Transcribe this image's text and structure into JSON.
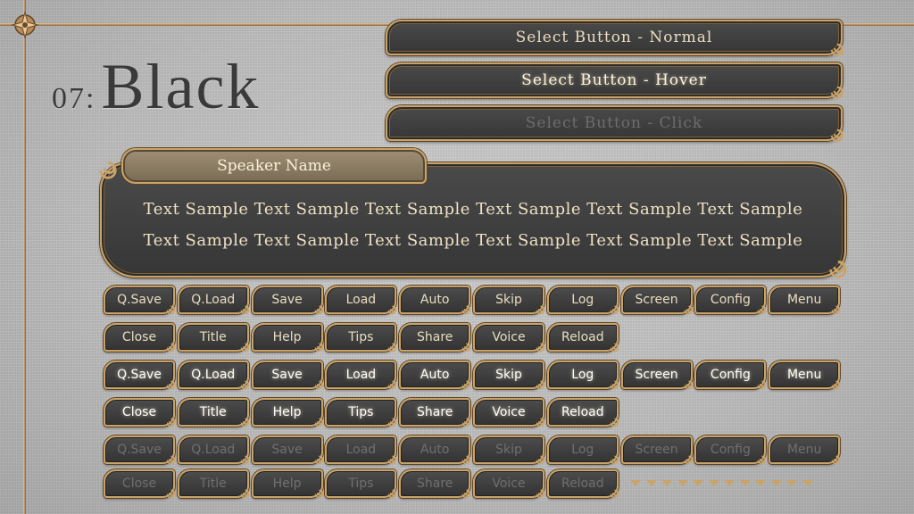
{
  "title": {
    "number": "07:",
    "word": "Black"
  },
  "select_buttons": [
    {
      "label": "Select Button - Normal",
      "state": "normal"
    },
    {
      "label": "Select Button - Hover",
      "state": "hover"
    },
    {
      "label": "Select Button - Click",
      "state": "click"
    }
  ],
  "message": {
    "speaker": "Speaker Name",
    "lines": [
      "Text Sample Text Sample Text Sample Text Sample Text Sample Text Sample",
      "Text Sample Text Sample Text Sample Text Sample Text Sample Text Sample"
    ]
  },
  "button_sets": [
    {
      "state": "normal",
      "row1": [
        "Q.Save",
        "Q.Load",
        "Save",
        "Load",
        "Auto",
        "Skip",
        "Log",
        "Screen",
        "Config",
        "Menu"
      ],
      "row2": [
        "Close",
        "Title",
        "Help",
        "Tips",
        "Share",
        "Voice",
        "Reload"
      ]
    },
    {
      "state": "hover",
      "row1": [
        "Q.Save",
        "Q.Load",
        "Save",
        "Load",
        "Auto",
        "Skip",
        "Log",
        "Screen",
        "Config",
        "Menu"
      ],
      "row2": [
        "Close",
        "Title",
        "Help",
        "Tips",
        "Share",
        "Voice",
        "Reload"
      ]
    },
    {
      "state": "disabled",
      "row1": [
        "Q.Save",
        "Q.Load",
        "Save",
        "Load",
        "Auto",
        "Skip",
        "Log",
        "Screen",
        "Config",
        "Menu"
      ],
      "row2": [
        "Close",
        "Title",
        "Help",
        "Tips",
        "Share",
        "Voice",
        "Reload"
      ]
    }
  ],
  "page_indicator_count": 12,
  "colors": {
    "gold": "#c9a46a",
    "panel": "#3a3a3a",
    "text": "#e9dcc0"
  }
}
